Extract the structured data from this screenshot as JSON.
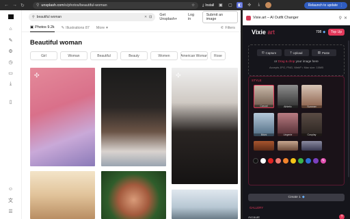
{
  "browser": {
    "url_host": "unsplash.com",
    "url_path": "/s/photos/beautiful-woman",
    "install_label": "Install",
    "relaunch_label": "Relaunch to update"
  },
  "unsplash": {
    "search_value": "beautiful woman",
    "get_plus_label": "Get Unsplash+",
    "login_label": "Log in",
    "submit_label": "Submit an image",
    "tabs": [
      {
        "label": "Photos 9.2k",
        "icon": "photo-icon",
        "active": true
      },
      {
        "label": "Illustrations 87",
        "icon": "illustration-icon",
        "active": false
      },
      {
        "label": "More",
        "icon": "chevron-down-icon",
        "active": false
      }
    ],
    "filters_label": "Filters",
    "page_title": "Beautiful woman",
    "chips": [
      "Girl",
      "Woman",
      "Beautiful",
      "Beauty",
      "Women",
      "American Woman",
      "Rose"
    ],
    "rail_icons": [
      "home-icon",
      "pen-icon",
      "settings-icon",
      "clock-icon",
      "folder-icon",
      "download-icon",
      "bookmark-icon",
      "profile-icon",
      "translate-icon",
      "menu-icon"
    ]
  },
  "extension": {
    "panel_title": "Vixie.art – AI Outfit Changer",
    "logo_main": "Vixie",
    "logo_sub": " art",
    "credits": "708",
    "topup_label": "Top Up",
    "upload_buttons": [
      {
        "label": "Capture",
        "icon": "capture-icon"
      },
      {
        "label": "Upload",
        "icon": "upload-icon"
      },
      {
        "label": "Paste",
        "icon": "paste-icon"
      }
    ],
    "drop_text_pre": "or ",
    "drop_text_link": "Drag & drop",
    "drop_text_post": " your image here",
    "accepts_text": "Accepts JPG, PNG, WebP • Max size: 10MB",
    "style_title": "STYLE",
    "styles": [
      {
        "label": "Casual",
        "selected": true
      },
      {
        "label": "Athletic",
        "selected": false
      },
      {
        "label": "Summer",
        "selected": false
      },
      {
        "label": "Bikini",
        "selected": false
      },
      {
        "label": "Lingerie",
        "selected": false
      },
      {
        "label": "Cosplay",
        "selected": false
      },
      {
        "label": "",
        "selected": false
      },
      {
        "label": "",
        "selected": false
      },
      {
        "label": "",
        "selected": false
      }
    ],
    "colors": [
      "#111111",
      "#ffffff",
      "#e02424",
      "#f07b72",
      "#f2832c",
      "#f5c518",
      "#3bb34a",
      "#2f6fd6",
      "#7b3fbf",
      "#e24fb0"
    ],
    "create_label": "Create 1",
    "gallery_label": "GALLERY",
    "account_label": "Account",
    "help_label": "?"
  }
}
